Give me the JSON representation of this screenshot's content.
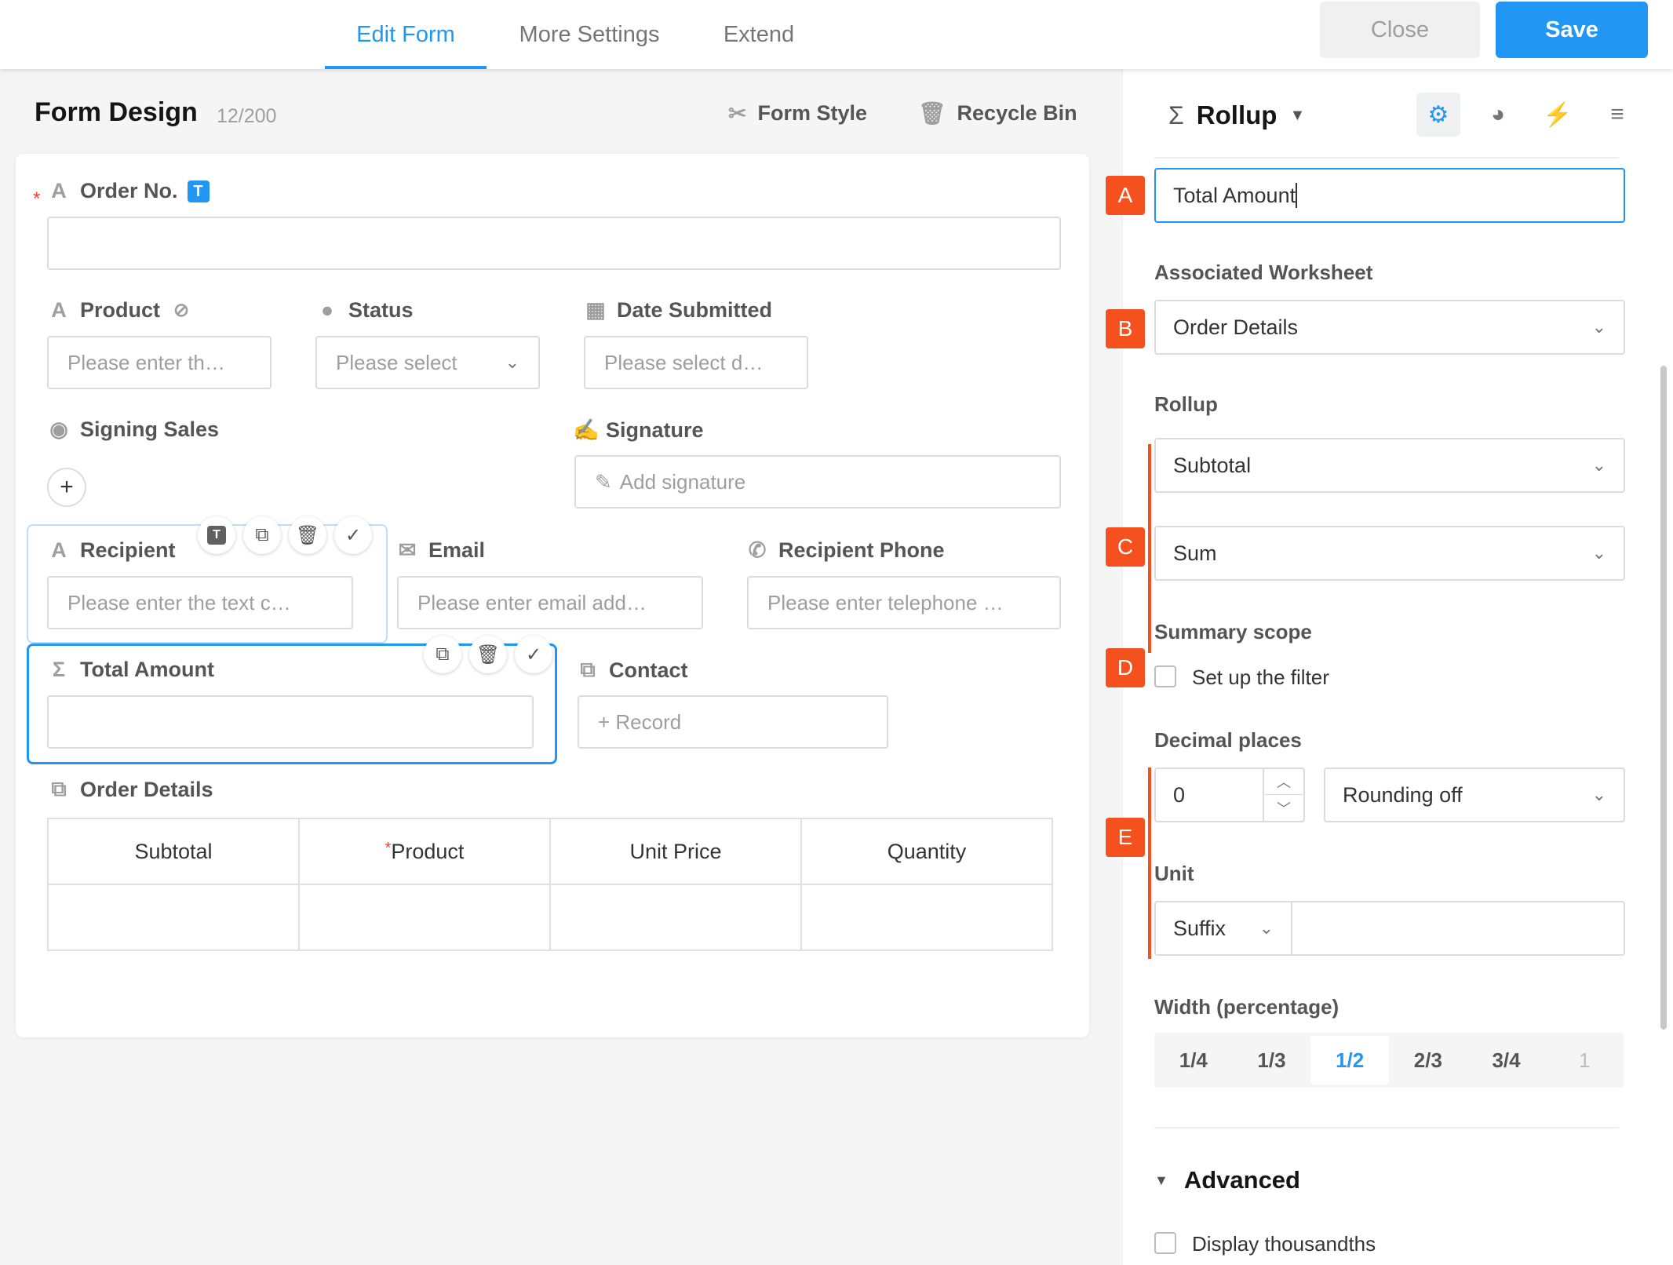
{
  "tabs": [
    {
      "label": "Edit Form"
    },
    {
      "label": "More Settings"
    },
    {
      "label": "Extend"
    }
  ],
  "header_buttons": {
    "close": "Close",
    "save": "Save"
  },
  "left_header": {
    "title": "Form Design",
    "count": "12/200",
    "form_style": "Form Style",
    "recycle_bin": "Recycle Bin"
  },
  "form": {
    "order_no": {
      "label": "Order No.",
      "badge": "T"
    },
    "product": {
      "label": "Product",
      "placeholder": "Please enter th…"
    },
    "status": {
      "label": "Status",
      "placeholder": "Please select"
    },
    "date_submitted": {
      "label": "Date Submitted",
      "placeholder": "Please select d…"
    },
    "signing_sales": {
      "label": "Signing Sales",
      "add": "+"
    },
    "signature": {
      "label": "Signature",
      "placeholder": "Add signature"
    },
    "recipient": {
      "label": "Recipient",
      "placeholder": "Please enter the text c…",
      "tool_badge": "T"
    },
    "email": {
      "label": "Email",
      "placeholder": "Please enter email add…"
    },
    "recipient_phone": {
      "label": "Recipient Phone",
      "placeholder": "Please enter telephone …"
    },
    "total_amount": {
      "label": "Total Amount"
    },
    "contact": {
      "label": "Contact",
      "placeholder": "+ Record"
    },
    "order_details": {
      "label": "Order Details",
      "columns": [
        "Subtotal",
        "Product",
        "Unit Price",
        "Quantity"
      ]
    }
  },
  "panel": {
    "title": "Rollup",
    "name_value": "Total Amount",
    "associated_worksheet": {
      "label": "Associated Worksheet",
      "value": "Order Details"
    },
    "rollup": {
      "label": "Rollup",
      "field": "Subtotal",
      "method": "Sum"
    },
    "summary_scope": {
      "label": "Summary scope",
      "checkbox": "Set up the filter"
    },
    "decimal_places": {
      "label": "Decimal places",
      "value": "0",
      "rounding": "Rounding off"
    },
    "unit": {
      "label": "Unit",
      "position": "Suffix",
      "value": ""
    },
    "width": {
      "label": "Width (percentage)",
      "options": [
        "1/4",
        "1/3",
        "1/2",
        "2/3",
        "3/4",
        "1"
      ],
      "selected": "1/2"
    },
    "advanced": {
      "label": "Advanced",
      "checkbox": "Display thousandths"
    },
    "markers": [
      "A",
      "B",
      "C",
      "D",
      "E"
    ]
  },
  "colors": {
    "accent": "#2196f3",
    "marker": "#f4511e",
    "required": "#f44336"
  }
}
